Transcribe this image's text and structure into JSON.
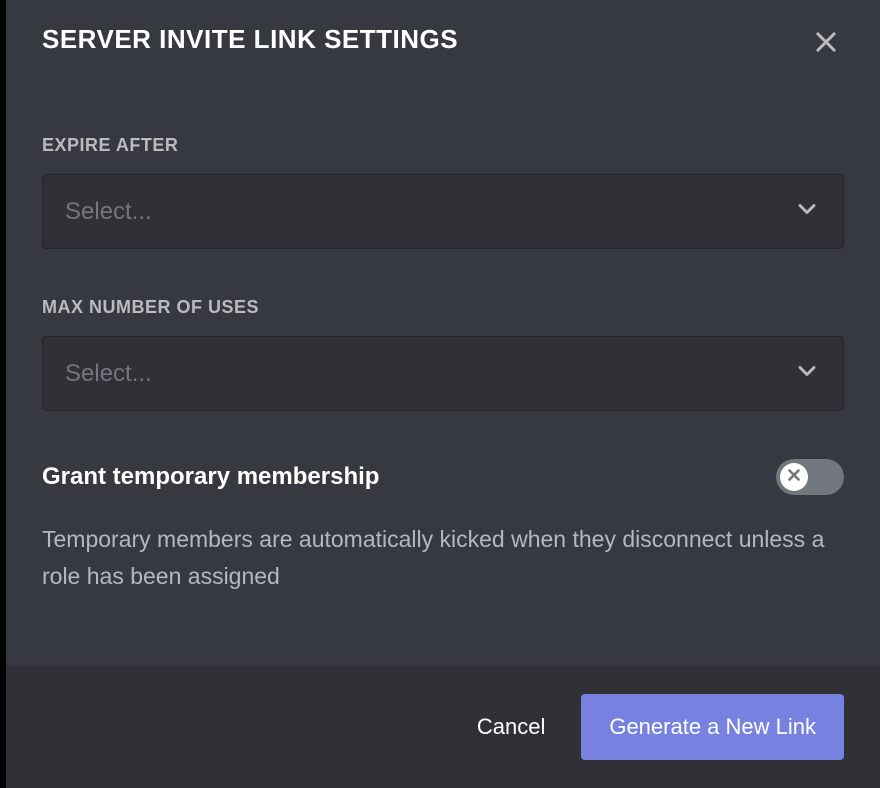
{
  "header": {
    "title": "SERVER INVITE LINK SETTINGS"
  },
  "fields": {
    "expire": {
      "label": "EXPIRE AFTER",
      "placeholder": "Select..."
    },
    "maxUses": {
      "label": "MAX NUMBER OF USES",
      "placeholder": "Select..."
    }
  },
  "toggle": {
    "label": "Grant temporary membership",
    "description": "Temporary members are automatically kicked when they disconnect unless a role has been assigned"
  },
  "footer": {
    "cancel": "Cancel",
    "generate": "Generate a New Link"
  }
}
